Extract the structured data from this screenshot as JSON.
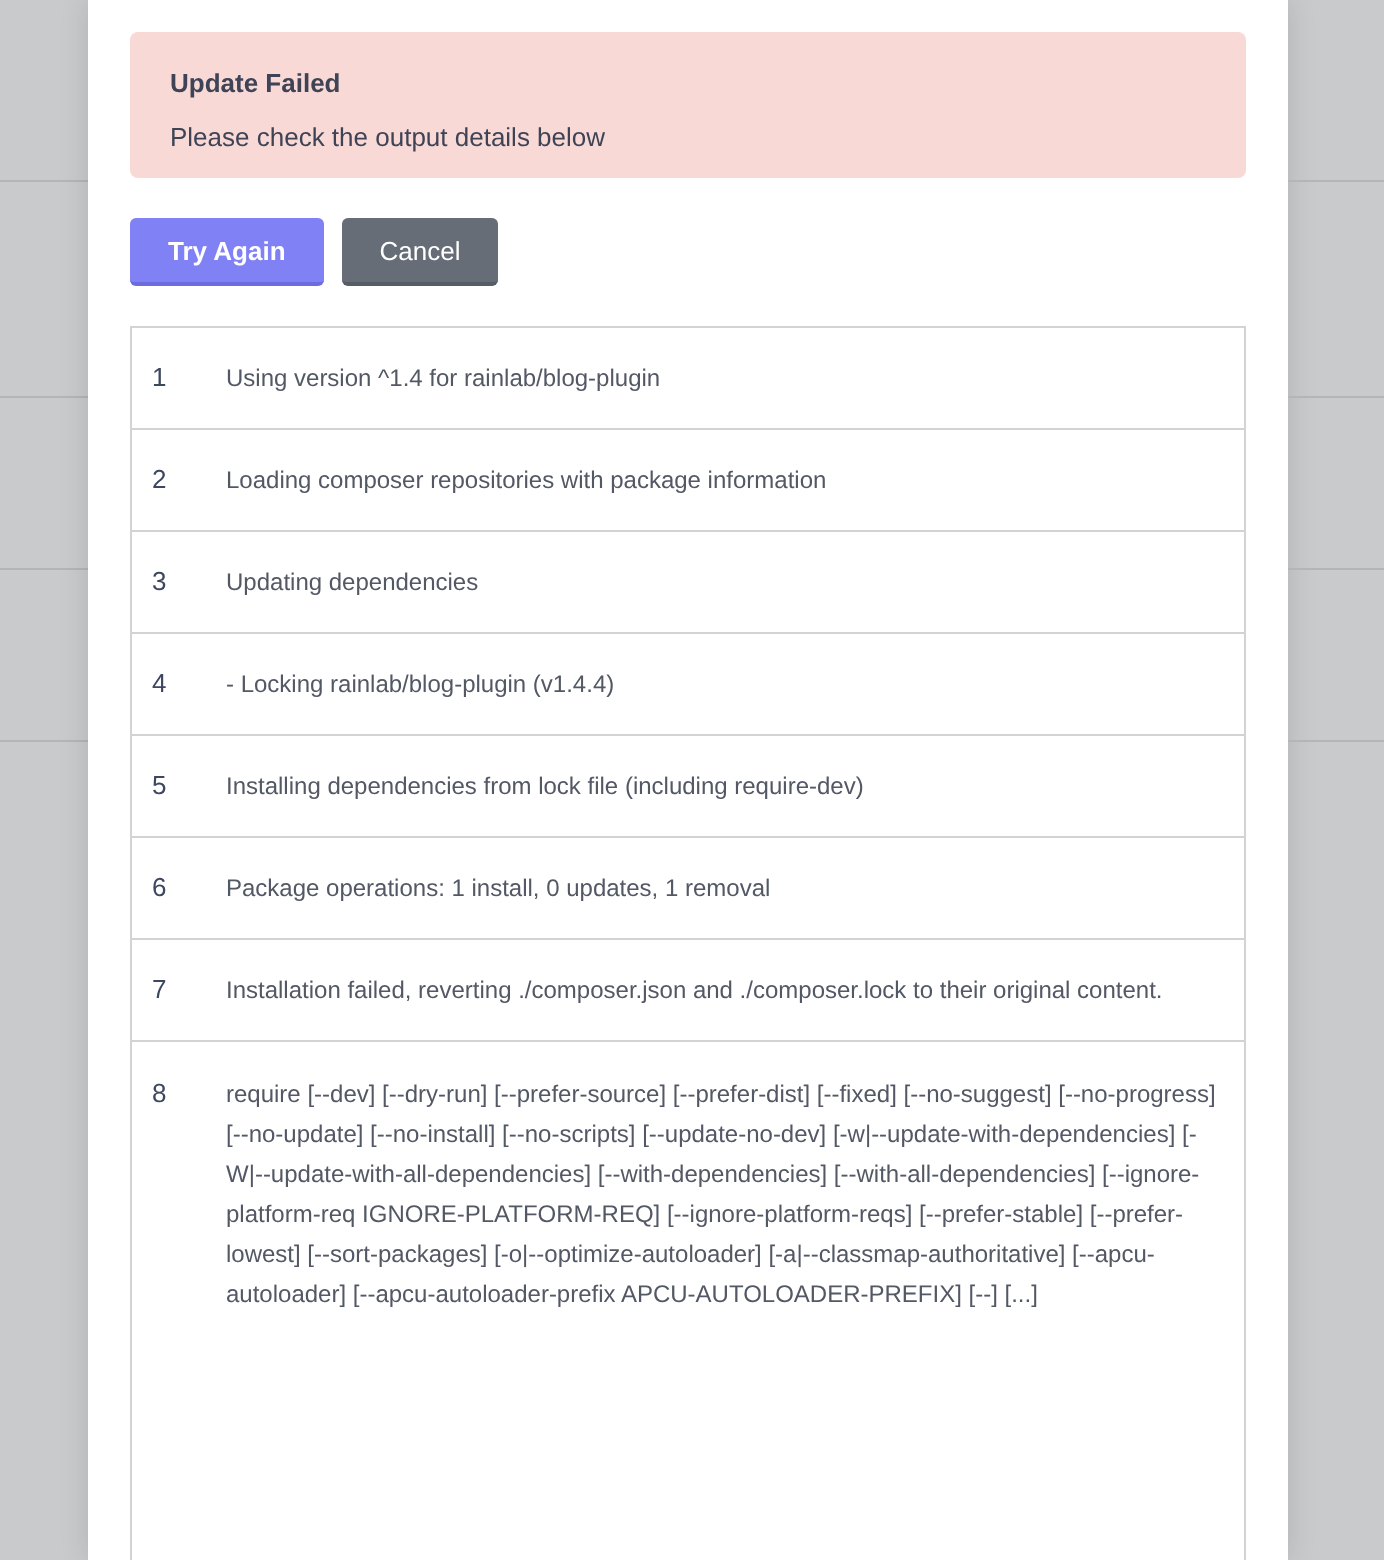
{
  "alert": {
    "title": "Update Failed",
    "message": "Please check the output details below"
  },
  "buttons": [
    {
      "label": "Try Again",
      "kind": "primary"
    },
    {
      "label": "Cancel",
      "kind": "secondary"
    }
  ],
  "output": {
    "lines": [
      {
        "number": "1",
        "text": "Using version ^1.4 for rainlab/blog-plugin"
      },
      {
        "number": "2",
        "text": "Loading composer repositories with package information"
      },
      {
        "number": "3",
        "text": "Updating dependencies"
      },
      {
        "number": "4",
        "text": "- Locking rainlab/blog-plugin (v1.4.4)"
      },
      {
        "number": "5",
        "text": "Installing dependencies from lock file (including require-dev)"
      },
      {
        "number": "6",
        "text": "Package operations: 1 install, 0 updates, 1 removal"
      },
      {
        "number": "7",
        "text": "Installation failed, reverting ./composer.json and ./composer.lock to their original content."
      },
      {
        "number": "8",
        "text": "require [--dev] [--dry-run] [--prefer-source] [--prefer-dist] [--fixed] [--no-suggest] [--no-progress] [--no-update] [--no-install] [--no-scripts] [--update-no-dev] [-w|--update-with-dependencies] [-W|--update-with-all-dependencies] [--with-dependencies] [--with-all-dependencies] [--ignore-platform-req IGNORE-PLATFORM-REQ] [--ignore-platform-reqs] [--prefer-stable] [--prefer-lowest] [--sort-packages] [-o|--optimize-autoloader] [-a|--classmap-authoritative] [--apcu-autoloader] [--apcu-autoloader-prefix APCU-AUTOLOADER-PREFIX] [--] [...]"
      }
    ]
  }
}
